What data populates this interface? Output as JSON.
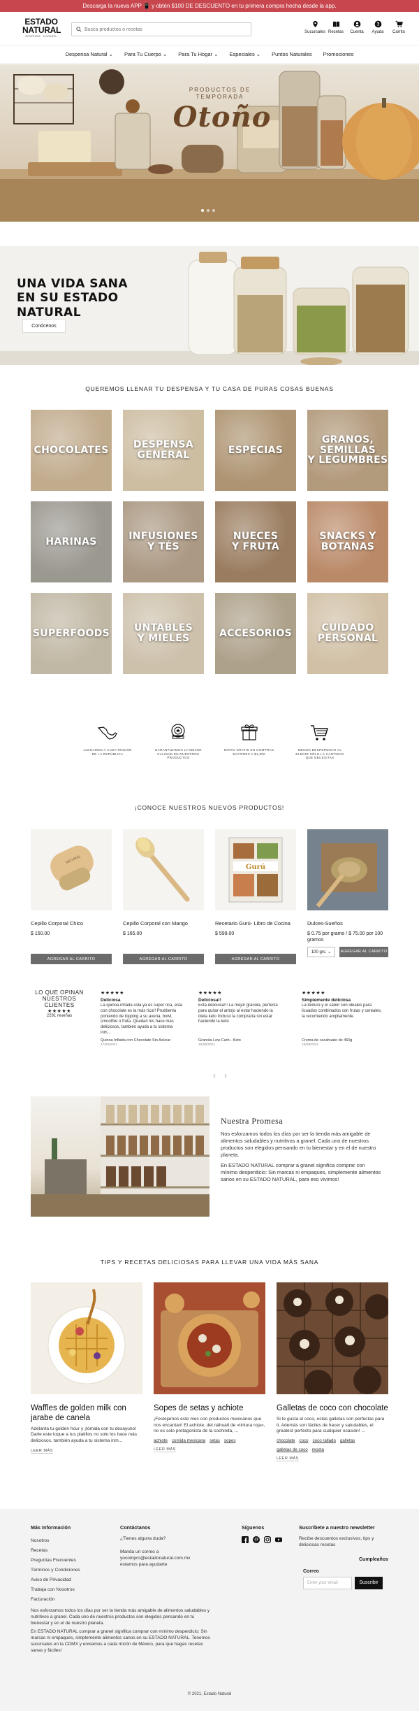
{
  "promo": {
    "text": "Descarga la nueva APP 📱 y obtén $100 DE DESCUENTO en tu primera compra hecha desde la app."
  },
  "brand": {
    "line1": "ESTADO",
    "line2": "NATURAL",
    "tagline": "DESPENSA · A GRANEL"
  },
  "search": {
    "placeholder": "Busca productos o recetas"
  },
  "header_icons": [
    {
      "label": "Sucursales",
      "icon": "location-pin-icon"
    },
    {
      "label": "Recetas",
      "icon": "book-icon"
    },
    {
      "label": "Cuenta",
      "icon": "user-icon"
    },
    {
      "label": "Ayuda",
      "icon": "help-icon"
    },
    {
      "label": "Carrito",
      "icon": "cart-icon"
    }
  ],
  "nav": [
    "Despensa Natural ⌄",
    "Para Tu Cuerpo ⌄",
    "Para Tu Hogar ⌄",
    "Especiales ⌄",
    "Puntos Naturales",
    "Promociones"
  ],
  "hero": {
    "kicker": "PRODUCTOS DE\nTEMPORADA",
    "title": "Otoño"
  },
  "about": {
    "title": "UNA VIDA SANA\nEN SU ESTADO NATURAL",
    "button": "Conócenos"
  },
  "categories_heading": "QUEREMOS LLENAR TU DESPENSA Y TU CASA DE PURAS COSAS BUENAS",
  "categories": [
    {
      "label": "CHOCOLATES",
      "bg": "#b9a07e"
    },
    {
      "label": "DESPENSA\nGENERAL",
      "bg": "#c7b596"
    },
    {
      "label": "ESPECIAS",
      "bg": "#a3865f"
    },
    {
      "label": "GRANOS,\nSEMILLAS\nY LEGUMBRES",
      "bg": "#a88c6a"
    },
    {
      "label": "HARINAS",
      "bg": "#8d8a80"
    },
    {
      "label": "INFUSIONES\nY TÉS",
      "bg": "#a08b72"
    },
    {
      "label": "NUECES\nY FRUTA",
      "bg": "#8c6b4a"
    },
    {
      "label": "SNACKS Y\nBOTANAS",
      "bg": "#b17a54"
    },
    {
      "label": "SUPERFOODS",
      "bg": "#b8ae98"
    },
    {
      "label": "UNTABLES\nY MIELES",
      "bg": "#c7b9a1"
    },
    {
      "label": "ACCESORIOS",
      "bg": "#a29479"
    },
    {
      "label": "CUIDADO\nPERSONAL",
      "bg": "#cbb89a"
    }
  ],
  "features": [
    {
      "icon": "mexico-map-icon",
      "text": "LLEGAMOS A CADA RINCÓN DE LA REPÚBLICA"
    },
    {
      "icon": "quality-badge-icon",
      "text": "GARANTIZAMOS LA MEJOR CALIDAD EN NUESTROS PRODUCTOS"
    },
    {
      "icon": "gift-box-icon",
      "text": "ENVÍO GRATIS EN COMPRAS MAYORES A $1,300"
    },
    {
      "icon": "cart-icon",
      "text": "MENOS DESPERDICIO AL ELEGIR SÓLO LA CANTIDAD QUE NECESITAS"
    }
  ],
  "products_heading": "¡CONOCE NUESTROS NUEVOS PRODUCTOS!",
  "products": [
    {
      "name": "Cepillo Corporal Chico",
      "price": "$ 150.00",
      "button": "AGREGAR AL CARRITO"
    },
    {
      "name": "Cepillo Corporal con Mango",
      "price": "$ 165.00",
      "button": "AGREGAR AL CARRITO"
    },
    {
      "name": "Recetario Gurú- Libro de Cocina",
      "price": "$ 599.00",
      "button": "AGREGAR AL CARRITO"
    },
    {
      "name": "Dulces-Sueños",
      "price": "$ 0.75 por gramo / $ 75.00 por 100 gramos",
      "variant": "100 grs. ⌄",
      "button": "AGREGAR AL CARRITO"
    }
  ],
  "reviews": {
    "summary_title": "LO QUE OPINAN NUESTROS CLIENTES",
    "summary_stars": "★★★★★",
    "summary_count": "2291 reseñas",
    "items": [
      {
        "stars": "★★★★★",
        "title": "Deliciosa",
        "body": "La quinoa inflada sola ya es súper rica, esta con chocolate es la más rica!! Pruébenla poniendo de topping a su avena, bowl, smoothie o fruta. Quedan los hace más deliciosos, también ayuda a tu sistema inm...",
        "product": "Quinoa Inflada con Chocolate Sin Azúcar",
        "date": "17/09/2021"
      },
      {
        "stars": "★★★★★",
        "title": "Deliciosa!!",
        "body": "Esta deliciosa!!! La mejor granola, perfecta para quitar el antojo al estar haciendo la dieta keto Incluso la compraría sin estar haciendo la keto",
        "product": "Granola Low Carb - Keto",
        "date": "16/09/2021"
      },
      {
        "stars": "★★★★★",
        "title": "Simplemente deliciosa",
        "body": "La textura y el sabor son ideales para licuados combinados con frutas y cereales, la recomiendo ampliamente.",
        "product": "Crema de cacahuate de 460g",
        "date": "16/09/2021"
      }
    ]
  },
  "promise": {
    "title": "Nuestra Promesa",
    "p1": "Nos esforzamos todos los días por ser la tienda más amigable de alimentos saludables y nutritivos a granel. Cada uno de nuestros productos son elegidos pensando en tu bienestar y en el de nuestro planeta.",
    "p2": "En ESTADO NATURAL comprar a granel significa comprar con mínimo desperdicio: Sin marcas ni empaques, simplemente alimentos sanos en su ESTADO NATURAL, para eso vivimos!"
  },
  "blog_heading": "TIPS Y RECETAS DELICIOSAS PARA LLEVAR UNA VIDA MÁS SANA",
  "blog": [
    {
      "title": "Waffles de golden milk con jarabe de canela",
      "excerpt": "Adelanta tu golden hour y ¡tómala con tu desayuno! Darle este toque a tus platillos no solo los hace más deliciosos, también ayuda a tu sistema inm...",
      "tags": [],
      "more": "LEER MÁS"
    },
    {
      "title": "Sopes de setas y achiote",
      "excerpt": "¡Festejamos este mes con productos mexicanos que nos encantan! El achiote, del náhuatl de «tintura roja», no es solo protagonista de la cochinita, ...",
      "tags": [
        "achiote",
        "comida mexicana",
        "setas",
        "sopes"
      ],
      "more": "LEER MÁS"
    },
    {
      "title": "Galletas de coco con chocolate",
      "excerpt": "Si te gusta el coco, estas galletas son perfectas para ti. Además son fáciles de hacer y saludables, el greatest perfecto para cualquier ocasión! ...",
      "tags": [
        "chocolate",
        "coco",
        "coco rallado",
        "galletas",
        "galletas de coco",
        "receta"
      ],
      "more": "LEER MÁS"
    }
  ],
  "footer": {
    "info_title": "Más Información",
    "info_links": [
      "Nosotros",
      "Recetas",
      "Preguntas Frecuentes",
      "Términos y Condiciones",
      "Aviso de Privacidad",
      "Trabaja con Nosotros",
      "Facturación"
    ],
    "contact_title": "Contáctanos",
    "contact_q": "¿Tienes alguna duda?",
    "contact_text": "Manda un correo a yocompro@estadonatural.com.mx estamos para ayudarte",
    "social_title": "Síguenos",
    "socials": [
      "facebook-icon",
      "pinterest-icon",
      "instagram-icon",
      "youtube-icon"
    ],
    "newsletter_title": "Suscríbete a nuestro newsletter",
    "newsletter_text": "Recibe descuentos exclusivos, tips y deliciosas recetas",
    "birthday_label": "Cumpleaños",
    "email_label": "Correo",
    "email_placeholder": "Enter your email",
    "subscribe": "Suscribir",
    "about_p1": "Nos esforzamos todos los días por ser la tienda más amigable de alimentos saludables y nutritivos a granel. Cada uno de nuestros productos son elegidos pensando en tu bienestar y en el de nuestro planeta.",
    "about_p2": "En ESTADO NATURAL comprar a granel significa comprar con mínimo desperdicio: Sin marcas ni empaques, simplemente alimentos sanos en su ESTADO NATURAL. Tenemos sucursales en la CDMX y enviamos a cada rincón de México, para que hagas recetas sanas y fáciles!",
    "copyright": "© 2021, Estado Natural"
  }
}
